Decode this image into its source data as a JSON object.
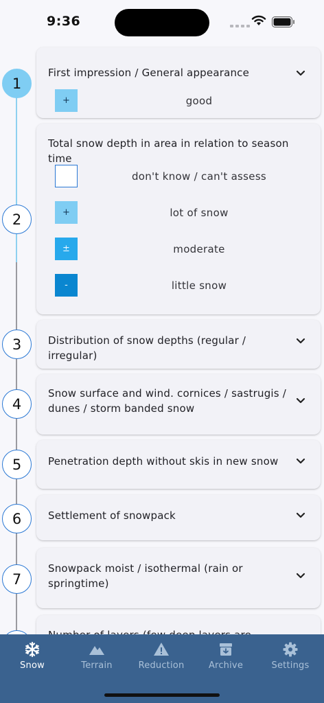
{
  "status_bar": {
    "time": "9:36"
  },
  "steps": [
    {
      "number": "1",
      "title": "First impression / General appearance",
      "active": true
    },
    {
      "number": "2",
      "title": "Total snow depth in area in relation to season time",
      "active": false
    },
    {
      "number": "3",
      "title": "Distribution of snow depths (regular / irregular)",
      "active": false
    },
    {
      "number": "4",
      "title": "Snow surface and wind. cornices / sastrugis / dunes / storm banded snow",
      "active": false
    },
    {
      "number": "5",
      "title": "Penetration depth without skis in new snow",
      "active": false
    },
    {
      "number": "6",
      "title": "Settlement of snowpack",
      "active": false
    },
    {
      "number": "7",
      "title": "Snowpack moist / isothermal (rain or springtime)",
      "active": false
    },
    {
      "number": "8",
      "title": "Number of layers (few deep layers are",
      "active": false
    }
  ],
  "step1_selected": {
    "symbol": "+",
    "label": "good"
  },
  "step2_options": [
    {
      "symbol": "",
      "label": "don't know / can't assess"
    },
    {
      "symbol": "+",
      "label": "lot of snow"
    },
    {
      "symbol": "±",
      "label": "moderate"
    },
    {
      "symbol": "-",
      "label": "little snow"
    }
  ],
  "colors": {
    "active_step": "#7fcdf3",
    "option_plus": "#7fcdf3",
    "option_moderate": "#27a9ec",
    "option_minus": "#0a86d0",
    "nav_background": "#3a628f"
  },
  "nav": [
    {
      "label": "Snow",
      "icon": "snowflake-icon",
      "active": true
    },
    {
      "label": "Terrain",
      "icon": "mountain-icon",
      "active": false
    },
    {
      "label": "Reduction",
      "icon": "warning-icon",
      "active": false
    },
    {
      "label": "Archive",
      "icon": "archive-icon",
      "active": false
    },
    {
      "label": "Settings",
      "icon": "gear-icon",
      "active": false
    }
  ]
}
